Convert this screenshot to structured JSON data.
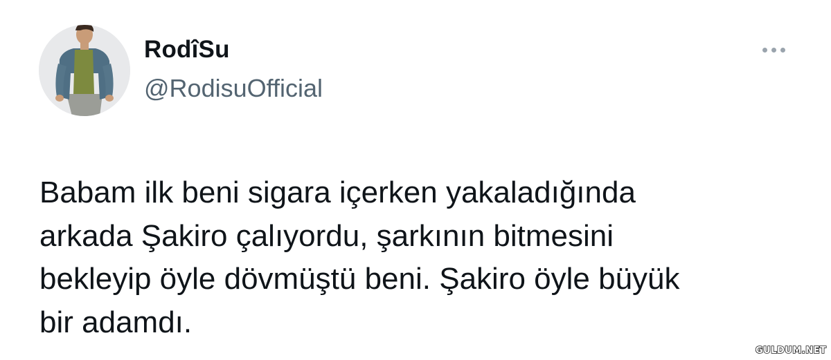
{
  "tweet": {
    "display_name": "RodîSu",
    "handle": "@RodisuOfficial",
    "more_icon": "more-horizontal-icon",
    "text_lines": [
      "Babam ilk beni sigara içerken yakaladığında",
      "arkada Şakiro çalıyordu, şarkının bitmesini",
      "bekleyip öyle dövmüştü beni. Şakiro öyle büyük",
      "bir adamdı."
    ]
  },
  "watermark": {
    "text": "GULDUM.NET"
  },
  "colors": {
    "name": "#0f1419",
    "handle": "#536471",
    "more_dots": "#9aa4ad",
    "background": "#ffffff"
  }
}
